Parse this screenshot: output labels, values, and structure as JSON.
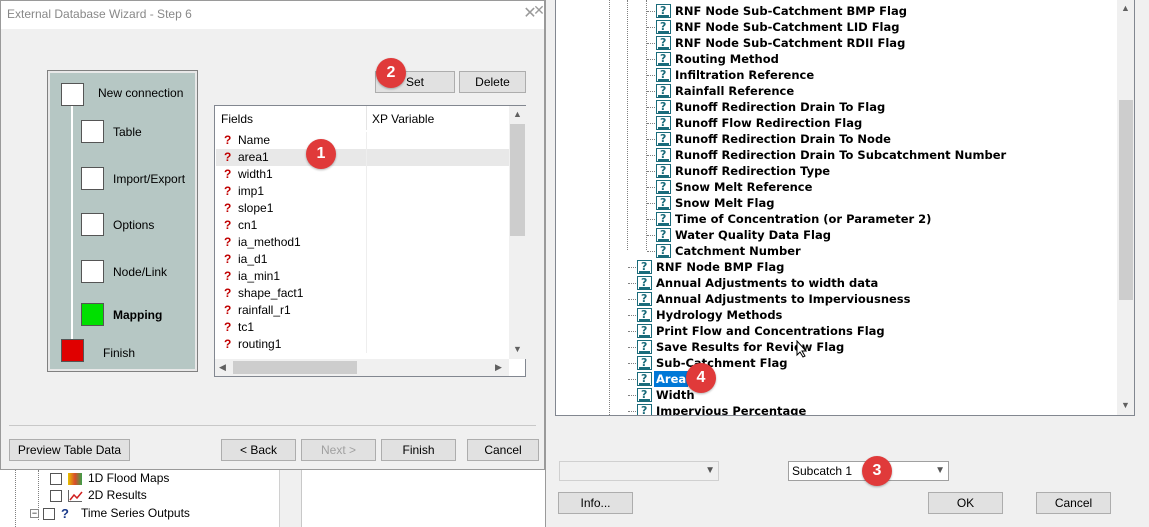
{
  "wizard": {
    "title": "External Database Wizard - Step 6",
    "close": "✕",
    "steps": [
      "New connection",
      "Table",
      "Import/Export",
      "Options",
      "Node/Link",
      "Mapping",
      "Finish"
    ],
    "colors": {
      "current": "#00e000",
      "finish": "#e00000",
      "panel": "#b6c7c4"
    },
    "set_label": "Set",
    "delete_label": "Delete",
    "fields": {
      "header_fields": "Fields",
      "header_xp": "XP Variable",
      "rows": [
        "Name",
        "area1",
        "width1",
        "imp1",
        "slope1",
        "cn1",
        "ia_method1",
        "ia_d1",
        "ia_min1",
        "shape_fact1",
        "rainfall_r1",
        "tc1",
        "routing1"
      ]
    },
    "buttons": {
      "preview": "Preview Table Data",
      "back": "< Back",
      "next": "Next >",
      "finish": "Finish",
      "cancel": "Cancel"
    }
  },
  "background_tree": {
    "items": [
      "1D Flood Maps",
      "2D Results",
      "Time Series Outputs"
    ]
  },
  "tree_dialog": {
    "close": "✕",
    "child_nodes": [
      "RNF Node Sub-Catchment BMP Flag",
      "RNF Node Sub-Catchment LID Flag",
      "RNF Node Sub-Catchment RDII Flag",
      "Routing Method",
      "Infiltration Reference",
      "Rainfall Reference",
      "Runoff Redirection Drain To Flag",
      "Runoff Flow Redirection Flag",
      "Runoff Redirection Drain To Node",
      "Runoff Redirection Drain To Subcatchment Number",
      "Runoff Redirection Type",
      "Snow Melt Reference",
      "Snow Melt Flag",
      "Time of Concentration (or Parameter 2)",
      "Water Quality Data Flag",
      "Catchment Number"
    ],
    "parent_nodes": [
      "RNF Node BMP Flag",
      "Annual Adjustments to width data",
      "Annual Adjustments to Imperviousness",
      "Hydrology Methods",
      "Print Flow and Concentrations Flag",
      "Save Results for Review Flag",
      "Sub-Catchment Flag",
      "Area",
      "Width",
      "Impervious Percentage"
    ],
    "selected": "Area",
    "subcatch_value": "Subcatch 1",
    "buttons": {
      "info": "Info...",
      "ok": "OK",
      "cancel": "Cancel"
    }
  },
  "badges": [
    "1",
    "2",
    "3",
    "4"
  ]
}
